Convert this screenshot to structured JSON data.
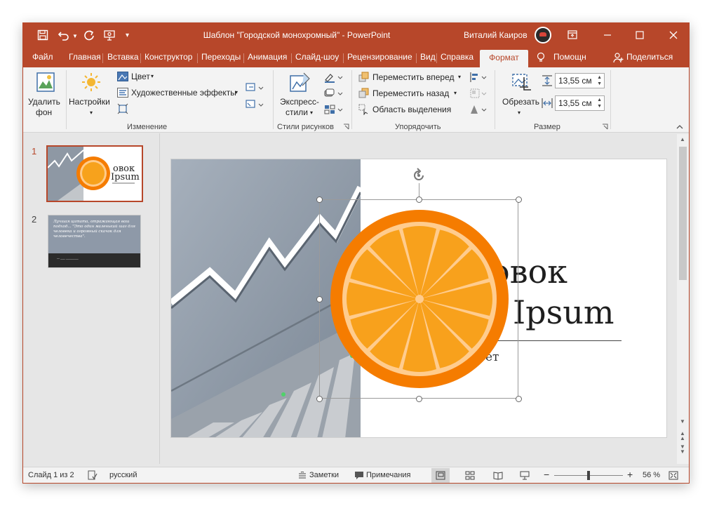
{
  "window": {
    "title": "Шаблон \"Городской монохромный\"  -  PowerPoint",
    "user_name": "Виталий Каиров",
    "accent": "#b7472a"
  },
  "quick_access": {
    "icons": [
      "save-icon",
      "undo-icon",
      "redo-icon",
      "present-from-start-icon",
      "customize-icon"
    ]
  },
  "window_controls": [
    "ribbon-display-icon",
    "minimize-icon",
    "maximize-icon",
    "close-icon"
  ],
  "tabs": [
    {
      "label": "Файл"
    },
    {
      "label": "Главная"
    },
    {
      "label": "Вставка"
    },
    {
      "label": "Конструктор"
    },
    {
      "label": "Переходы"
    },
    {
      "label": "Анимация"
    },
    {
      "label": "Слайд-шоу"
    },
    {
      "label": "Рецензирование"
    },
    {
      "label": "Вид"
    },
    {
      "label": "Справка"
    },
    {
      "label": "Формат"
    }
  ],
  "tab_help": "Помощн",
  "tab_share": "Поделиться",
  "ribbon": {
    "remove_bg": {
      "line1": "Удалить",
      "line2": "фон"
    },
    "corrections": "Настройки",
    "color": "Цвет",
    "artistic": "Художественные эффекты",
    "group_adjust": "Изменение",
    "quick_styles": {
      "line1": "Экспресс-",
      "line2": "стили"
    },
    "group_styles": "Стили рисунков",
    "bring_forward": "Переместить вперед",
    "send_backward": "Переместить назад",
    "selection_pane": "Область выделения",
    "group_arrange": "Упорядочить",
    "crop": "Обрезать",
    "height": "13,55 см",
    "width": "13,55 см",
    "group_size": "Размер"
  },
  "thumbnails": [
    {
      "number": "1",
      "title_frag": "овок",
      "sub_frag": "Ipsum"
    },
    {
      "number": "2",
      "quote": "Лучшая цитата, отражающая ваш подход... \"Это один маленький шаг для человека и огромный скачок для человечества\".",
      "author": "— ___ ________"
    }
  ],
  "slide": {
    "title_line1": "овок",
    "title_line2": "Ipsum",
    "sub_frag": "ет"
  },
  "status": {
    "slide_of": "Слайд 1 из 2",
    "language": "русский",
    "notes": "Заметки",
    "comments": "Примечания",
    "zoom": "56 %",
    "zoom_fraction": 0.5
  }
}
